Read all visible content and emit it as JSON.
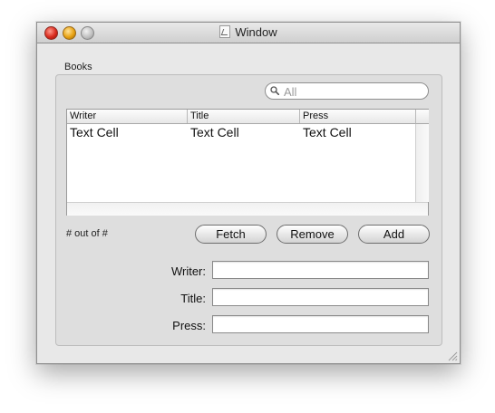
{
  "window": {
    "title": "Window"
  },
  "group": {
    "label": "Books"
  },
  "search": {
    "placeholder": "All"
  },
  "table": {
    "columns": [
      "Writer",
      "Title",
      "Press"
    ],
    "rows": [
      [
        "Text Cell",
        "Text Cell",
        "Text Cell"
      ]
    ]
  },
  "status": {
    "count_text": "# out of #"
  },
  "buttons": {
    "fetch": "Fetch",
    "remove": "Remove",
    "add": "Add"
  },
  "form": {
    "writer_label": "Writer:",
    "title_label": "Title:",
    "press_label": "Press:",
    "writer_value": "",
    "title_value": "",
    "press_value": ""
  }
}
